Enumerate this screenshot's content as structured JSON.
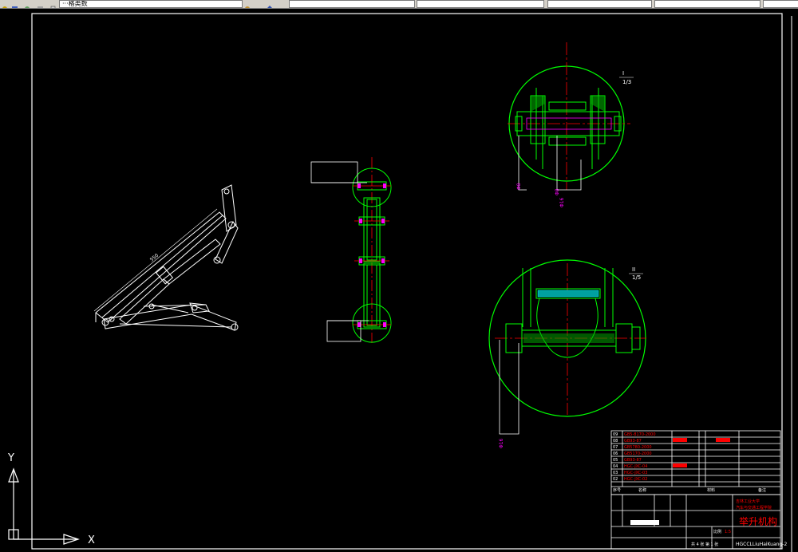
{
  "toolbar": {
    "layer_field": "···格类数",
    "field_2": "",
    "field_3": "",
    "field_4": "",
    "field_5": "",
    "field_6": ""
  },
  "drawing": {
    "bg_color": "#000000",
    "line_color": "#ffffff",
    "green_color": "#00ff00",
    "red_color": "#ff0000",
    "magenta_color": "#ff00ff",
    "detail_I_label": "I",
    "detail_I_scale": "1/3",
    "detail_II_label": "II",
    "detail_II_scale": "1/5",
    "dim_front": "550"
  },
  "title_block": {
    "parts": [
      {
        "no": "09",
        "code": "GB5-8170-2000"
      },
      {
        "no": "08",
        "code": "GB93-87"
      },
      {
        "no": "07",
        "code": "GB5780-2000"
      },
      {
        "no": "06",
        "code": "GB5170-2000"
      },
      {
        "no": "05",
        "code": "GB93-87"
      },
      {
        "no": "04",
        "code": "HGC-JXC-04"
      },
      {
        "no": "03",
        "code": "HGC-JXC-03"
      },
      {
        "no": "02",
        "code": "HGC-JXC-02"
      }
    ],
    "header_no": "序号",
    "header_name": "名称",
    "header_material": "材料",
    "header_note": "备注",
    "university": "吉林工业大学",
    "department": "汽车与交通工程学院",
    "title": "举升机构",
    "drawing_code": "HGCCLLiuHaiKuang-2",
    "sheet_info": "共 4 张  第 1 张",
    "scale_label": "比例",
    "scale_value": "1:5"
  },
  "ucs": {
    "x_label": "X",
    "y_label": "Y"
  }
}
